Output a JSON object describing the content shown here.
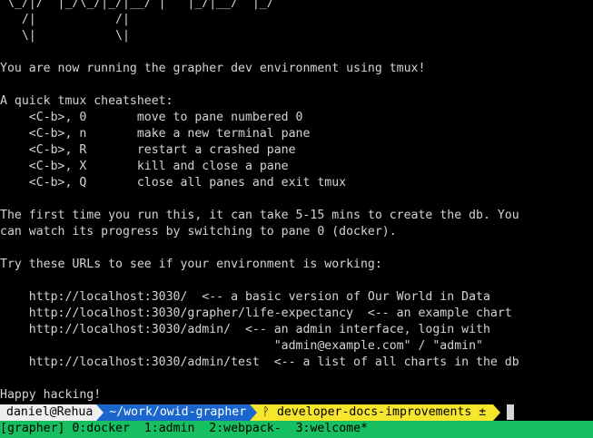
{
  "terminal_lines": [
    " \\_/|/  |_/\\_/|_/|__/ |   |_/|__/  |_/",
    "   /|           /|",
    "   \\|           \\|",
    "",
    "You are now running the grapher dev environment using tmux!",
    "",
    "A quick tmux cheatsheet:",
    "    <C-b>, 0       move to pane numbered 0",
    "    <C-b>, n       make a new terminal pane",
    "    <C-b>, R       restart a crashed pane",
    "    <C-b>, X       kill and close a pane",
    "    <C-b>, Q       close all panes and exit tmux",
    "",
    "The first time you run this, it can take 5-15 mins to create the db. You",
    "can watch its progress by switching to pane 0 (docker).",
    "",
    "Try these URLs to see if your environment is working:",
    "",
    "    http://localhost:3030/  <-- a basic version of Our World in Data",
    "    http://localhost:3030/grapher/life-expectancy  <-- an example chart",
    "    http://localhost:3030/admin/  <-- an admin interface, login with",
    "                                      \"admin@example.com\" / \"admin\"",
    "    http://localhost:3030/admin/test  <-- a list of all charts in the db",
    "",
    "Happy hacking!"
  ],
  "prompt": {
    "user_host": "daniel@Rehua",
    "path": "~/work/owid-grapher",
    "git_branch": "ᚹ developer-docs-improvements ±"
  },
  "statusbar": {
    "session": "[grapher]",
    "windows": [
      " 0:docker",
      "  1:admin",
      "  2:webpack-",
      "  3:welcome*"
    ]
  },
  "colors": {
    "background": "#000000",
    "foreground": "#d4d4d4",
    "prompt_user_bg": "#eeeeee",
    "prompt_path_bg": "#1a66cc",
    "prompt_git_bg": "#f5e52c",
    "statusbar_bg": "#16c060"
  }
}
